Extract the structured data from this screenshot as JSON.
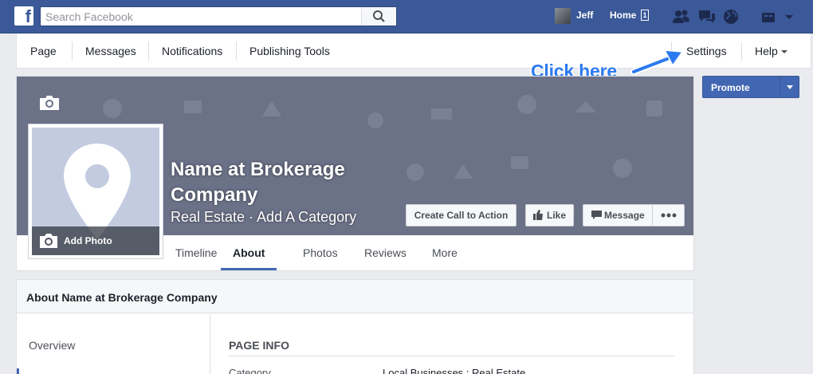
{
  "topbar": {
    "search_placeholder": "Search Facebook",
    "user_name": "Jeff",
    "home_label": "Home",
    "home_count": "1"
  },
  "page_nav": {
    "items": [
      "Page",
      "Messages",
      "Notifications",
      "Publishing Tools"
    ],
    "settings": "Settings",
    "help": "Help"
  },
  "annotation": {
    "text": "Click here",
    "color": "#2d7af0"
  },
  "promote": {
    "label": "Promote"
  },
  "cover": {
    "add_photo": "Add Photo",
    "page_name": "Name at Brokerage Company",
    "category": "Real Estate · Add A Category"
  },
  "actions": {
    "call_to_action": "Create Call to Action",
    "like": "Like",
    "message": "Message"
  },
  "tabs": [
    "Timeline",
    "About",
    "Photos",
    "Reviews",
    "More"
  ],
  "active_tab": "About",
  "about": {
    "heading": "About Name at Brokerage Company",
    "sidebar_overview": "Overview",
    "section_title": "PAGE INFO",
    "category_key": "Category",
    "category_value": "Local Businesses : Real Estate"
  },
  "colors": {
    "facebook_blue": "#3b5998",
    "button_blue": "#4267b2",
    "cover_gray": "#6b7187"
  }
}
